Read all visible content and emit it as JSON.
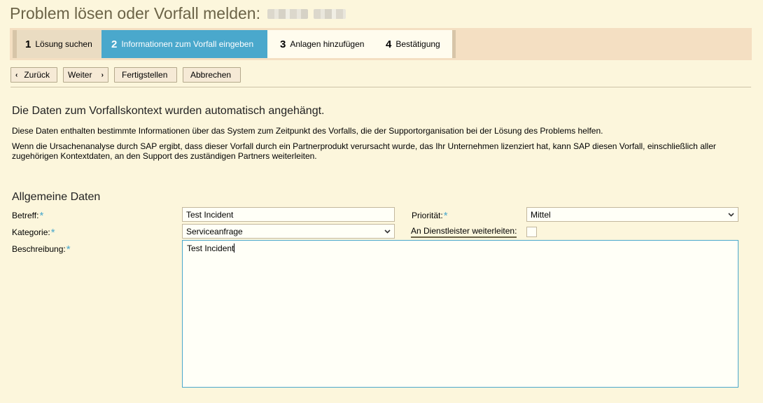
{
  "page": {
    "title": "Problem lösen oder Vorfall melden:"
  },
  "roadmap": {
    "steps": [
      {
        "num": "1",
        "label": "Lösung suchen"
      },
      {
        "num": "2",
        "label": "Informationen zum Vorfall eingeben"
      },
      {
        "num": "3",
        "label": "Anlagen hinzufügen"
      },
      {
        "num": "4",
        "label": "Bestätigung"
      }
    ]
  },
  "toolbar": {
    "back_label": "Zurück",
    "next_label": "Weiter",
    "finish_label": "Fertigstellen",
    "cancel_label": "Abbrechen"
  },
  "content": {
    "heading": "Die Daten zum Vorfallskontext wurden automatisch angehängt.",
    "para1": "Diese Daten enthalten bestimmte Informationen über das System zum Zeitpunkt des Vorfalls, die der Supportorganisation bei der Lösung des Problems helfen.",
    "para2": "Wenn die Ursachenanalyse durch SAP ergibt, dass dieser Vorfall durch ein Partnerprodukt verursacht wurde, das Ihr Unternehmen lizenziert hat, kann SAP diesen Vorfall, einschließlich aller zugehörigen Kontextdaten, an den Support des zuständigen Partners weiterleiten."
  },
  "form": {
    "section_title": "Allgemeine Daten",
    "required_mark": "*",
    "subject_label": "Betreff:",
    "subject_value": "Test Incident",
    "category_label": "Kategorie:",
    "category_value": "Serviceanfrage",
    "description_label": "Beschreibung:",
    "description_value": "Test Incident",
    "priority_label": "Priorität:",
    "priority_value": "Mittel",
    "forward_label": "An Dienstleister weiterleiten:",
    "forward_checked": false
  },
  "colors": {
    "accent": "#4aa8cc",
    "background": "#fcf6dc",
    "roadmap_bg": "#f4dfc2",
    "title": "#6b6347"
  }
}
